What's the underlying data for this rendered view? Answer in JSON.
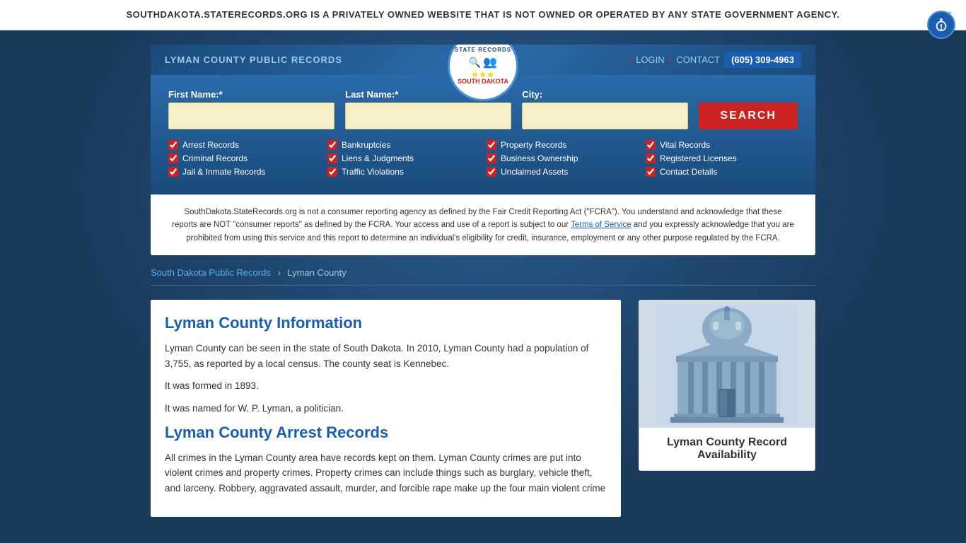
{
  "banner": {
    "text": "SOUTHDAKOTA.STATERECORDS.ORG IS A PRIVATELY OWNED WEBSITE THAT IS NOT OWNED OR OPERATED BY ANY STATE GOVERNMENT AGENCY.",
    "close_label": "×"
  },
  "header": {
    "county_title": "LYMAN COUNTY PUBLIC RECORDS",
    "logo": {
      "top_text": "STATE RECORDS",
      "bottom_text": "SOUTH DAKOTA"
    },
    "nav": {
      "login_label": "LOGIN",
      "contact_label": "CONTACT",
      "phone": "(605) 309-4963"
    }
  },
  "search": {
    "first_name_label": "First Name:*",
    "last_name_label": "Last Name:*",
    "city_label": "City:",
    "first_name_placeholder": "",
    "last_name_placeholder": "",
    "city_placeholder": "",
    "button_label": "SEARCH"
  },
  "checkboxes": [
    {
      "label": "Arrest Records",
      "checked": true
    },
    {
      "label": "Bankruptcies",
      "checked": true
    },
    {
      "label": "Property Records",
      "checked": true
    },
    {
      "label": "Vital Records",
      "checked": true
    },
    {
      "label": "Criminal Records",
      "checked": true
    },
    {
      "label": "Liens & Judgments",
      "checked": true
    },
    {
      "label": "Business Ownership",
      "checked": true
    },
    {
      "label": "Registered Licenses",
      "checked": true
    },
    {
      "label": "Jail & Inmate Records",
      "checked": true
    },
    {
      "label": "Traffic Violations",
      "checked": true
    },
    {
      "label": "Unclaimed Assets",
      "checked": true
    },
    {
      "label": "Contact Details",
      "checked": true
    }
  ],
  "disclaimer": {
    "text1": "SouthDakota.StateRecords.org is not a consumer reporting agency as defined by the Fair Credit Reporting Act (\"FCRA\"). You understand and acknowledge that these reports are NOT \"consumer reports\" as defined by the FCRA. Your access and use of a report is subject to our ",
    "tos_link": "Terms of Service",
    "text2": " and you expressly acknowledge that you are prohibited from using this service and this report to determine an individual's eligibility for credit, insurance, employment or any other purpose regulated by the FCRA."
  },
  "breadcrumb": {
    "parent_label": "South Dakota Public Records",
    "current_label": "Lyman County"
  },
  "content": {
    "info_title": "Lyman County Information",
    "info_p1": "Lyman County can be seen in the state of South Dakota. In 2010, Lyman County had a population of 3,755, as reported by a local census. The county seat is Kennebec.",
    "info_p2": "It was formed in 1893.",
    "info_p3": "It was named for W. P. Lyman, a politician.",
    "arrest_title": "Lyman County Arrest Records",
    "arrest_p1": "All crimes in the Lyman County area have records kept on them. Lyman County crimes are put into violent crimes and property crimes. Property crimes can include things such as burglary, vehicle theft, and larceny. Robbery, aggravated assault, murder, and forcible rape make up the four main violent crime"
  },
  "sidebar": {
    "card_title": "Lyman County Record Availability"
  }
}
